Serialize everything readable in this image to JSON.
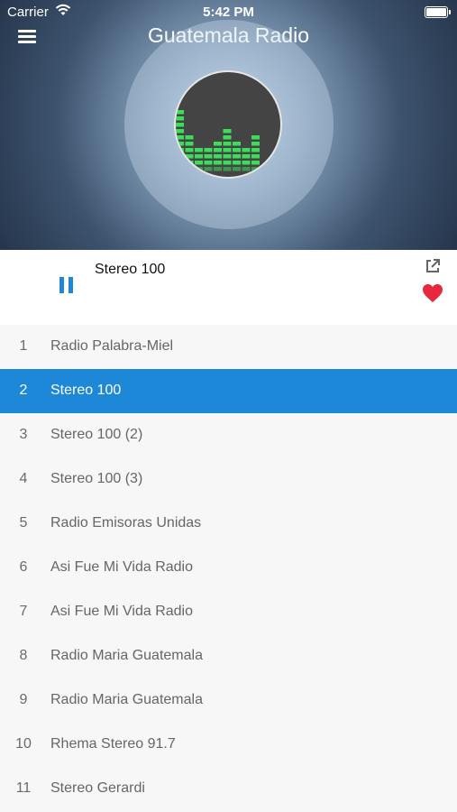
{
  "status_bar": {
    "carrier": "Carrier",
    "time": "5:42 PM"
  },
  "header": {
    "title": "Guatemala Radio",
    "menu_icon": "hamburger-menu-icon"
  },
  "player": {
    "now_playing": "Stereo 100",
    "state": "playing",
    "accent_color": "#1e88d8",
    "favorite_color": "#e8283c",
    "equalizer_color": "#3ddc5a"
  },
  "stations": [
    {
      "num": "1",
      "name": "Radio Palabra-Miel",
      "active": false
    },
    {
      "num": "2",
      "name": "Stereo 100",
      "active": true
    },
    {
      "num": "3",
      "name": "Stereo 100 (2)",
      "active": false
    },
    {
      "num": "4",
      "name": "Stereo 100 (3)",
      "active": false
    },
    {
      "num": "5",
      "name": "Radio Emisoras Unidas",
      "active": false
    },
    {
      "num": "6",
      "name": "Asi Fue Mi Vida Radio",
      "active": false
    },
    {
      "num": "7",
      "name": "Asi Fue Mi Vida Radio",
      "active": false
    },
    {
      "num": "8",
      "name": "Radio Maria Guatemala",
      "active": false
    },
    {
      "num": "9",
      "name": "Radio Maria Guatemala",
      "active": false
    },
    {
      "num": "10",
      "name": "Rhema Stereo 91.7",
      "active": false
    },
    {
      "num": "11",
      "name": "Stereo Gerardi",
      "active": false
    }
  ]
}
